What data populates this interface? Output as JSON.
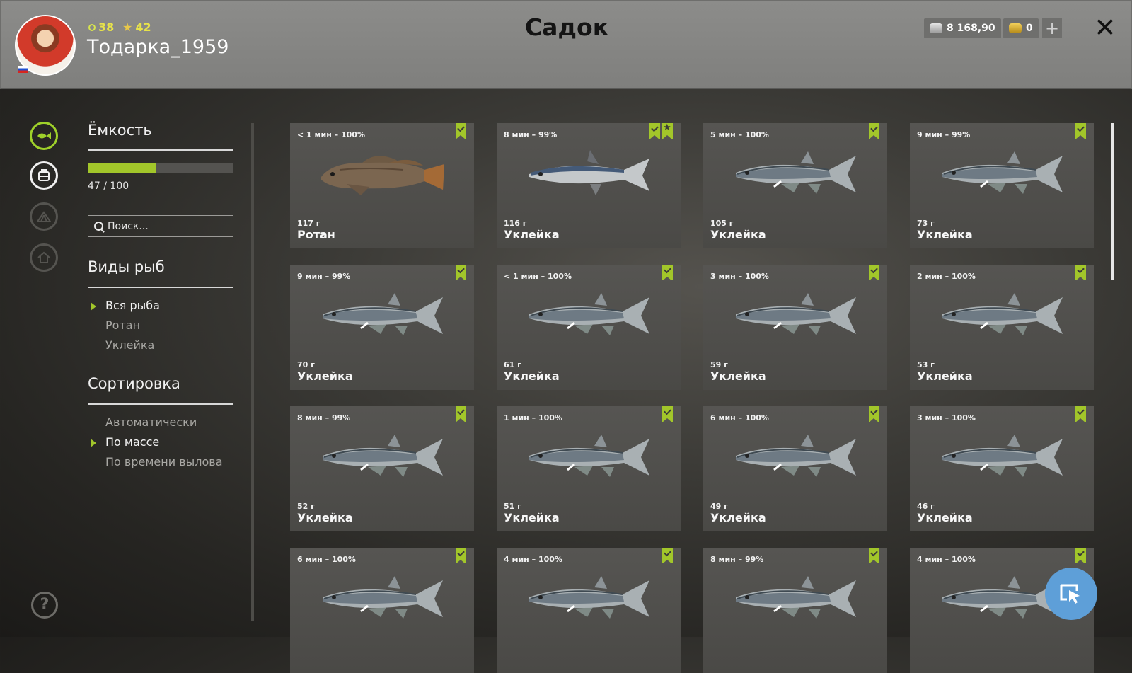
{
  "header": {
    "title": "Садок",
    "username": "Тодарка_1959",
    "level": "38",
    "rank": "42",
    "silver": "8 168,90",
    "gold": "0",
    "plus": "+",
    "close": "✕"
  },
  "sidebar": {
    "capacity_title": "Ёмкость",
    "capacity_text": "47 / 100",
    "capacity_fraction": 0.47,
    "search_placeholder": "Поиск...",
    "species_title": "Виды рыб",
    "species": [
      "Вся рыба",
      "Ротан",
      "Уклейка"
    ],
    "species_selected": 0,
    "sort_title": "Сортировка",
    "sort": [
      "Автоматически",
      "По массе",
      "По времени вылова"
    ],
    "sort_selected": 1
  },
  "help": "?",
  "fish": [
    {
      "time": "< 1 мин – 100%",
      "weight": "117 г",
      "name": "Ротан",
      "star": false,
      "kind": "rotan"
    },
    {
      "time": "8 мин – 99%",
      "weight": "116 г",
      "name": "Уклейка",
      "star": true,
      "kind": "ukleika2"
    },
    {
      "time": "5 мин – 100%",
      "weight": "105 г",
      "name": "Уклейка",
      "star": false,
      "kind": "ukleika"
    },
    {
      "time": "9 мин – 99%",
      "weight": "73 г",
      "name": "Уклейка",
      "star": false,
      "kind": "ukleika"
    },
    {
      "time": "9 мин – 99%",
      "weight": "70 г",
      "name": "Уклейка",
      "star": false,
      "kind": "ukleika"
    },
    {
      "time": "< 1 мин – 100%",
      "weight": "61 г",
      "name": "Уклейка",
      "star": false,
      "kind": "ukleika"
    },
    {
      "time": "3 мин – 100%",
      "weight": "59 г",
      "name": "Уклейка",
      "star": false,
      "kind": "ukleika"
    },
    {
      "time": "2 мин – 100%",
      "weight": "53 г",
      "name": "Уклейка",
      "star": false,
      "kind": "ukleika"
    },
    {
      "time": "8 мин – 99%",
      "weight": "52 г",
      "name": "Уклейка",
      "star": false,
      "kind": "ukleika"
    },
    {
      "time": "1 мин – 100%",
      "weight": "51 г",
      "name": "Уклейка",
      "star": false,
      "kind": "ukleika"
    },
    {
      "time": "6 мин – 100%",
      "weight": "49 г",
      "name": "Уклейка",
      "star": false,
      "kind": "ukleika"
    },
    {
      "time": "3 мин – 100%",
      "weight": "46 г",
      "name": "Уклейка",
      "star": false,
      "kind": "ukleika"
    },
    {
      "time": "6 мин – 100%",
      "weight": "",
      "name": "",
      "star": false,
      "kind": "ukleika"
    },
    {
      "time": "4 мин – 100%",
      "weight": "",
      "name": "",
      "star": false,
      "kind": "ukleika"
    },
    {
      "time": "8 мин – 99%",
      "weight": "",
      "name": "",
      "star": false,
      "kind": "ukleika"
    },
    {
      "time": "4 мин – 100%",
      "weight": "",
      "name": "",
      "star": false,
      "kind": "ukleika"
    }
  ],
  "icons": {
    "rail": [
      "fish-tab-icon",
      "keepnet-tab-icon",
      "camp-tab-icon",
      "home-tab-icon"
    ],
    "fab": "cursor-mode-icon"
  },
  "colors": {
    "accent": "#a2c62a",
    "fab": "#5e9fd8",
    "header_bg": "#858583"
  }
}
